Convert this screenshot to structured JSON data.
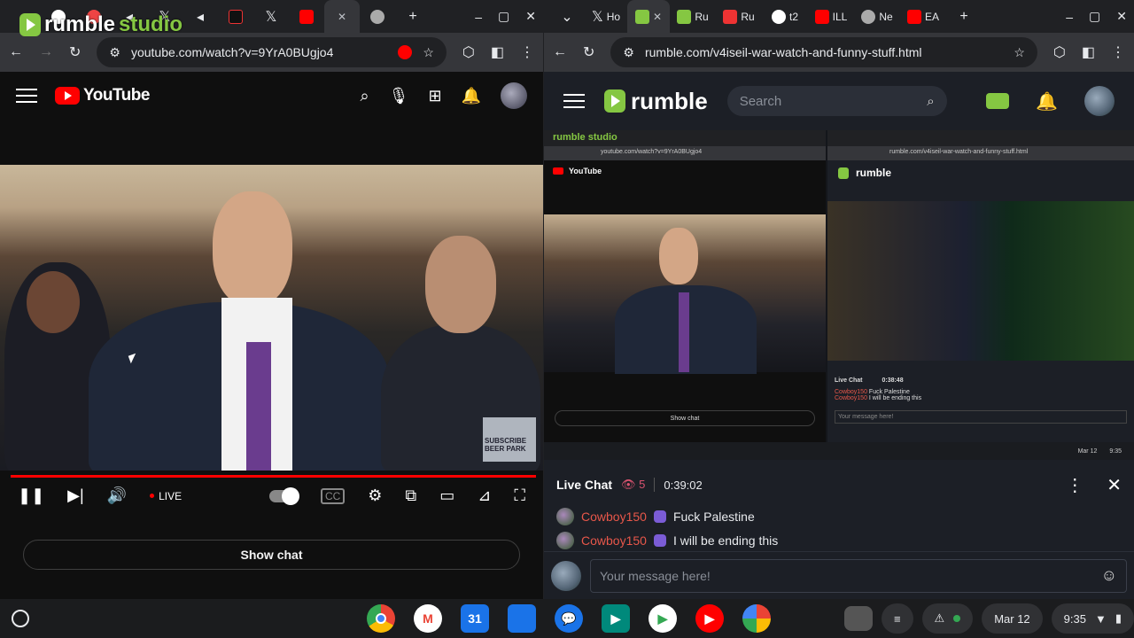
{
  "left_window": {
    "tabs": [
      {
        "icon": "chevron-down-icon",
        "label": ""
      },
      {
        "icon": "github-icon",
        "label": ""
      },
      {
        "icon": "record-icon",
        "label": ""
      },
      {
        "icon": "audio-icon",
        "label": ""
      },
      {
        "icon": "x-icon",
        "label": ""
      },
      {
        "icon": "audio-icon",
        "label": ""
      },
      {
        "icon": "tiktok-icon",
        "label": ""
      },
      {
        "icon": "x-icon",
        "label": ""
      },
      {
        "icon": "youtube-icon",
        "label": ""
      },
      {
        "icon": "close-icon",
        "label": "✕"
      },
      {
        "icon": "chrome-icon",
        "label": ""
      },
      {
        "icon": "new-tab-icon",
        "label": "+"
      }
    ],
    "url": "youtube.com/watch?v=9YrA0BUgjo4",
    "studio_watermark": {
      "part1": "rumble",
      "part2": " studio"
    }
  },
  "youtube": {
    "logo_text": "YouTube",
    "live_label": "LIVE",
    "show_chat_label": "Show chat",
    "progress": 1.0,
    "overlay_text": "SUBSCRIBE BEER PARK"
  },
  "right_window": {
    "tabs": [
      {
        "icon": "x-icon",
        "label": "Ho"
      },
      {
        "icon": "rumble-icon",
        "label": ""
      },
      {
        "icon": "rumble-icon",
        "label": "Ru"
      },
      {
        "icon": "alert-icon",
        "label": "Ru"
      },
      {
        "icon": "google-icon",
        "label": "t2"
      },
      {
        "icon": "youtube-icon",
        "label": "ILL"
      },
      {
        "icon": "chrome-icon",
        "label": "Ne"
      },
      {
        "icon": "youtube-icon",
        "label": "EA"
      }
    ],
    "url": "rumble.com/v4iseil-war-watch-and-funny-stuff.html"
  },
  "rumble": {
    "brand": "rumble",
    "search_placeholder": "Search",
    "nested": {
      "studio_label": "rumble studio",
      "yt_url": "youtube.com/watch?v=9YrA0BUgjo4",
      "rumble_url": "rumble.com/v4iseil-war-watch-and-funny-stuff.html",
      "show_chat": "Show chat",
      "live_chat": "Live Chat",
      "timer": "0:38:48",
      "msg1_user": "Cowboy150",
      "msg1_text": "Fuck Palestine",
      "msg2_user": "Cowboy150",
      "msg2_text": "I will be ending this",
      "composer": "Your message here!",
      "date": "Mar 12",
      "time": "9:35"
    },
    "chat": {
      "title": "Live Chat",
      "viewers": "5",
      "timer": "0:39:02",
      "messages": [
        {
          "user": "Cowboy150",
          "text": "Fuck Palestine"
        },
        {
          "user": "Cowboy150",
          "text": "I will be ending this"
        }
      ],
      "composer_placeholder": "Your message here!"
    }
  },
  "shelf": {
    "apps": [
      {
        "name": "chrome-icon",
        "color": "#4285f4",
        "label": ""
      },
      {
        "name": "gmail-icon",
        "color": "#ffffff",
        "label": "M"
      },
      {
        "name": "calendar-icon",
        "color": "#1a73e8",
        "label": "31"
      },
      {
        "name": "files-icon",
        "color": "#1a73e8",
        "label": ""
      },
      {
        "name": "messages-icon",
        "color": "#1a73e8",
        "label": ""
      },
      {
        "name": "meet-icon",
        "color": "#00897b",
        "label": ""
      },
      {
        "name": "play-store-icon",
        "color": "#ffffff",
        "label": ""
      },
      {
        "name": "youtube-icon",
        "color": "#ff0000",
        "label": ""
      },
      {
        "name": "photos-icon",
        "color": "#ffffff",
        "label": ""
      }
    ],
    "date": "Mar 12",
    "time": "9:35"
  },
  "colors": {
    "rumble_green": "#85c742",
    "youtube_red": "#ff0000",
    "chat_user": "#e8574a"
  }
}
